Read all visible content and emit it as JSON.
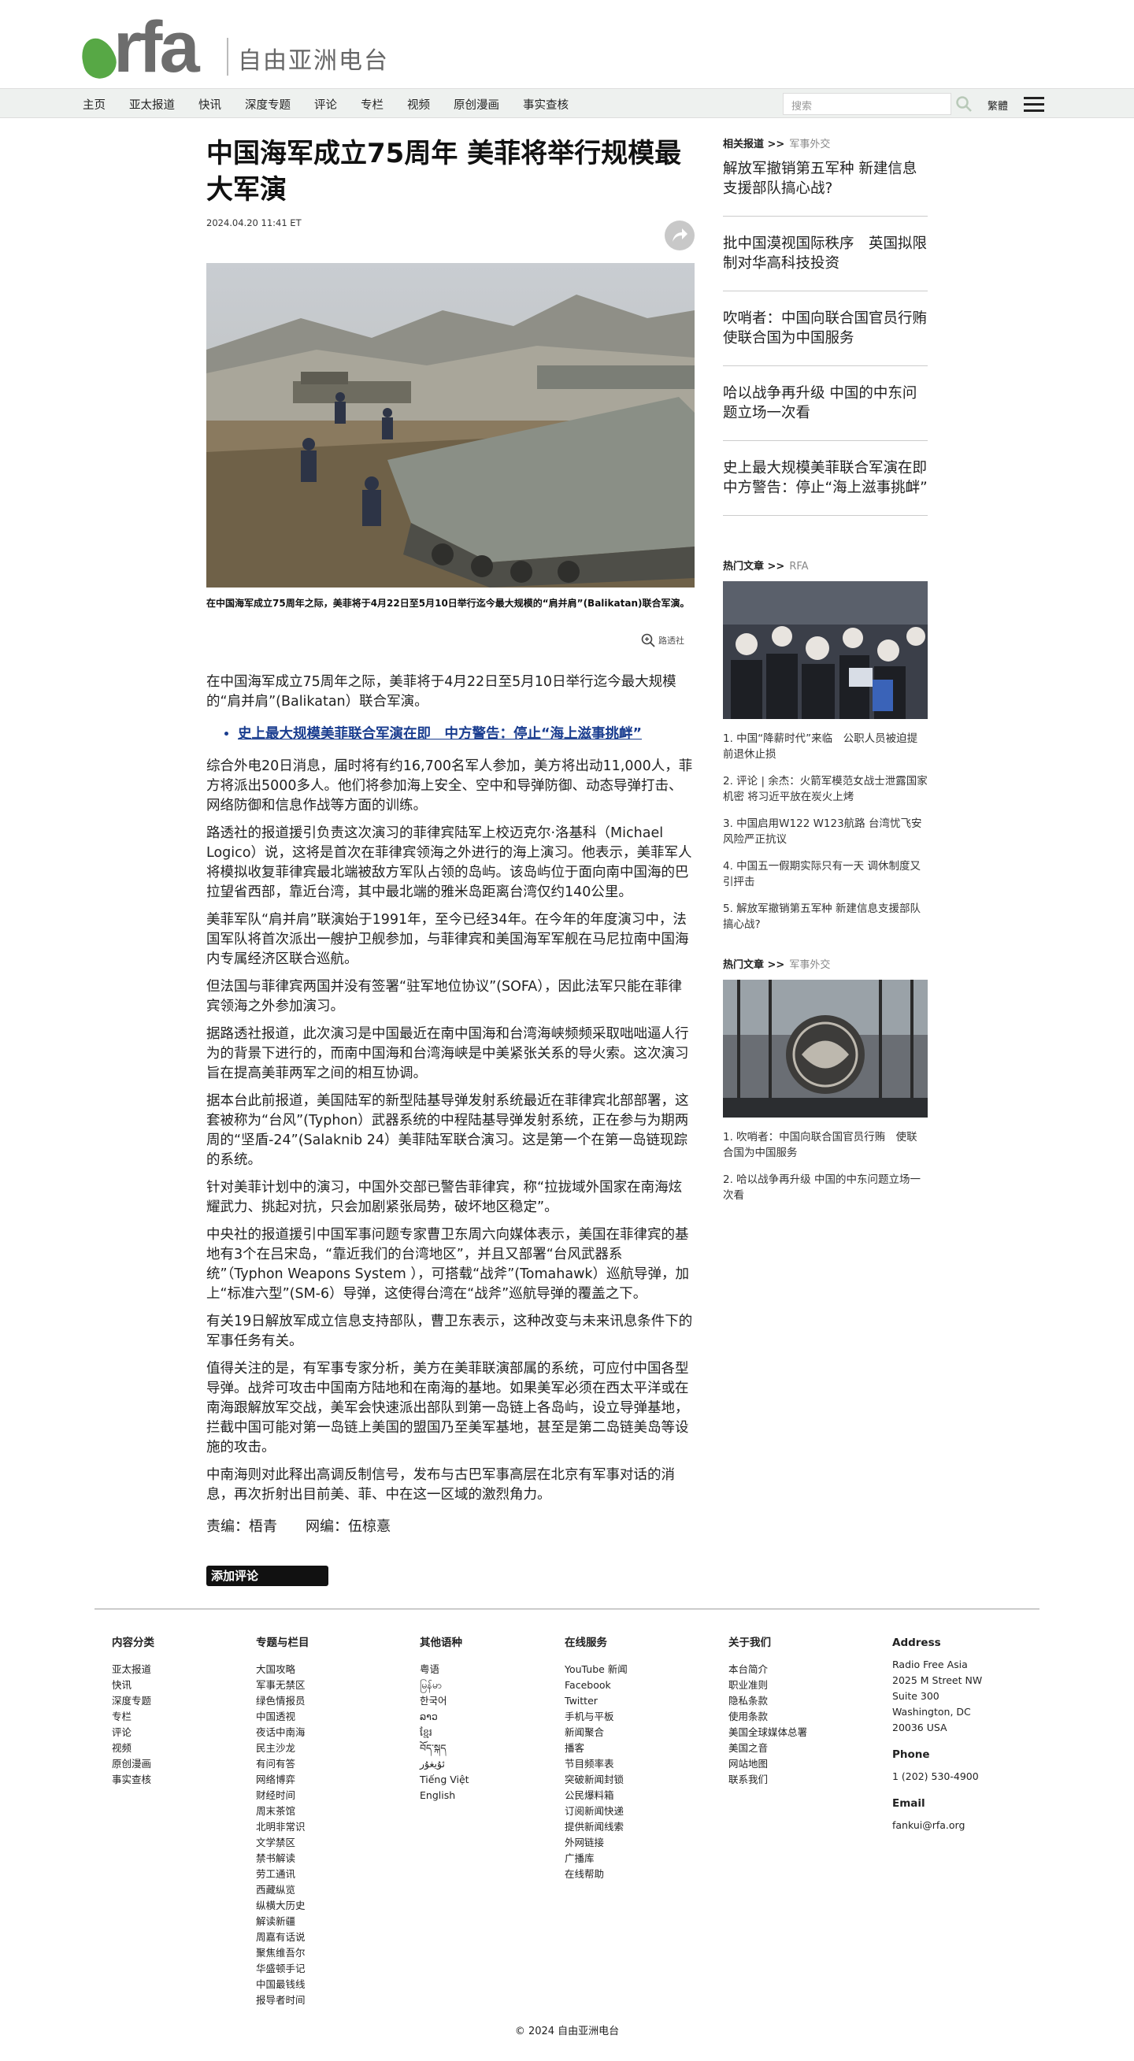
{
  "header": {
    "logo_text": "rfa",
    "logo_cn": "自由亚洲电台",
    "nav": [
      "主页",
      "亚太报道",
      "快讯",
      "深度专题",
      "评论",
      "专栏",
      "视频",
      "原创漫画",
      "事实查核"
    ],
    "search_placeholder": "搜索",
    "lang_label": "繁體"
  },
  "article": {
    "title": "中国海军成立75周年 美菲将举行规模最大军演",
    "date": "2024.04.20 11:41 ET",
    "caption": "在中国海军成立75周年之际，美菲将于4月22日至5月10日举行迄今最大规模的“肩并肩”(Balikatan)联合军演。",
    "credit": "路透社",
    "lead": "在中国海军成立75周年之际，美菲将于4月22日至5月10日举行迄今最大规模的“肩并肩”(Balikatan）联合军演。",
    "related_link": "史上最大规模美菲联合军演在即　中方警告：停止“海上滋事挑衅”",
    "paragraphs": [
      "综合外电20日消息，届时将有约16,700名军人参加，美方将出动11,000人，菲方将派出5000多人。他们将参加海上安全、空中和导弹防御、动态导弹打击、网络防御和信息作战等方面的训练。",
      "路透社的报道援引负责这次演习的菲律宾陆军上校迈克尔·洛基科（Michael Logico）说，这将是首次在菲律宾领海之外进行的海上演习。他表示，美菲军人将模拟收复菲律宾最北端被敌方军队占领的岛屿。该岛屿位于面向南中国海的巴拉望省西部，靠近台湾，其中最北端的雅米岛距离台湾仅约140公里。",
      "美菲军队“肩并肩”联演始于1991年，至今已经34年。在今年的年度演习中，法国军队将首次派出一艘护卫舰参加，与菲律宾和美国海军军舰在马尼拉南中国海内专属经济区联合巡航。",
      "但法国与菲律宾两国并没有签署“驻军地位协议”(SOFA），因此法军只能在菲律宾领海之外参加演习。",
      "据路透社报道，此次演习是中国最近在南中国海和台湾海峡频频采取咄咄逼人行为的背景下进行的，而南中国海和台湾海峡是中美紧张关系的导火索。这次演习旨在提高美菲两军之间的相互协调。",
      "据本台此前报道，美国陆军的新型陆基导弹发射系统最近在菲律宾北部部署，这套被称为“台风”(Typhon）武器系统的中程陆基导弹发射系统，正在参与为期两周的“坚盾-24”(Salaknib 24）美菲陆军联合演习。这是第一个在第一岛链现踪的系统。",
      "针对美菲计划中的演习，中国外交部已警告菲律宾，称“拉拢域外国家在南海炫耀武力、挑起对抗，只会加剧紧张局势，破坏地区稳定”。",
      "中央社的报道援引中国军事问题专家曹卫东周六向媒体表示，美国在菲律宾的基地有3个在吕宋岛，“靠近我们的台湾地区”，并且又部署“台风武器系统”（Typhon Weapons System ），可搭载“战斧”(Tomahawk）巡航导弹，加上“标准六型”(SM-6）导弹，这使得台湾在“战斧”巡航导弹的覆盖之下。",
      "有关19日解放军成立信息支持部队，曹卫东表示，这种改变与未来讯息条件下的军事任务有关。",
      "值得关注的是，有军事专家分析，美方在美菲联演部属的系统，可应付中国各型导弹。战斧可攻击中国南方陆地和在南海的基地。如果美军必须在西太平洋或在南海跟解放军交战，美军会快速派出部队到第一岛链上各岛屿，设立导弹基地，拦截中国可能对第一岛链上美国的盟国乃至美军基地，甚至是第二岛链美岛等设施的攻击。",
      "中南海则对此释出高调反制信号，发布与古巴军事高层在北京有军事对话的消息，再次折射出目前美、菲、中在这一区域的激烈角力。"
    ],
    "editors": "责编：梧青　　网编：伍椋憙",
    "comment_button": "添加评论"
  },
  "sidebar": {
    "related_heading": "相关报道 >>",
    "related_tag": "军事外交",
    "related": [
      "解放军撤销第五军种 新建信息支援部队搞心战?",
      "批中国漠视国际秩序　英国拟限制对华高科技投资",
      "吹哨者：中国向联合国官员行贿　使联合国为中国服务",
      "哈以战争再升级 中国的中东问题立场一次看",
      "史上最大规模美菲联合军演在即　中方警告：停止“海上滋事挑衅”"
    ],
    "hot1_heading": "热门文章 >>",
    "hot1_tag": "RFA",
    "hot1": [
      "1. 中国“降薪时代”来临　公职人员被迫提前退休止损",
      "2. 评论 | 余杰：火箭军模范女战士泄露国家机密 将习近平放在炭火上烤",
      "3. 中国启用W122 W123航路 台湾忧飞安风险严正抗议",
      "4. 中国五一假期实际只有一天 调休制度又引抨击",
      "5. 解放军撤销第五军种 新建信息支援部队搞心战?"
    ],
    "hot2_heading": "热门文章 >>",
    "hot2_tag": "军事外交",
    "hot2": [
      "1. 吹哨者：中国向联合国官员行贿　使联合国为中国服务",
      "2. 哈以战争再升级 中国的中东问题立场一次看"
    ]
  },
  "footer": {
    "col1": {
      "title": "内容分类",
      "items": [
        "亚太报道",
        "快讯",
        "深度专题",
        "专栏",
        "评论",
        "视频",
        "原创漫画",
        "事实查核"
      ]
    },
    "col2": {
      "title": "专题与栏目",
      "items": [
        "大国攻略",
        "军事无禁区",
        "绿色情报员",
        "中国透视",
        "夜话中南海",
        "民主沙龙",
        "有问有答",
        "网络博弈",
        "财经时间",
        "周末茶馆",
        "北明非常识",
        "文学禁区",
        "禁书解读",
        "劳工通讯",
        "西藏纵览",
        "纵横大历史",
        "解读新疆",
        "周嘉有话说",
        "聚焦维吾尔",
        "华盛顿手记",
        "中国最钱线",
        "报导者时间"
      ]
    },
    "col3": {
      "title": "其他语种",
      "items": [
        "粤语",
        "မြန်မာ",
        "한국어",
        "ລາວ",
        "ខ្មែរ",
        "བོད་སྐད",
        "ئۇيغۇر",
        "Tiếng Việt",
        "English"
      ]
    },
    "col4": {
      "title": "在线服务",
      "items": [
        "YouTube 新闻",
        "Facebook",
        "Twitter",
        "手机与平板",
        "新闻聚合",
        "播客",
        "节目频率表",
        "突破新闻封锁",
        "公民爆料箱",
        "订阅新闻快递",
        "提供新闻线索",
        "外网链接",
        "广播库",
        "在线帮助"
      ]
    },
    "col5": {
      "title": "关于我们",
      "items": [
        "本台简介",
        "职业准则",
        "隐私条款",
        "使用条款",
        "美国全球媒体总署",
        "美国之音",
        "网站地图",
        "联系我们"
      ]
    },
    "col6": {
      "title": "Address",
      "address": [
        "Radio Free Asia",
        "2025 M Street NW",
        "Suite 300",
        "Washington, DC",
        "20036 USA"
      ],
      "phone_title": "Phone",
      "phone": "1 (202) 530-4900",
      "email_title": "Email",
      "email": "fankui@rfa.org"
    },
    "copyright": "© 2024 自由亚洲电台"
  }
}
